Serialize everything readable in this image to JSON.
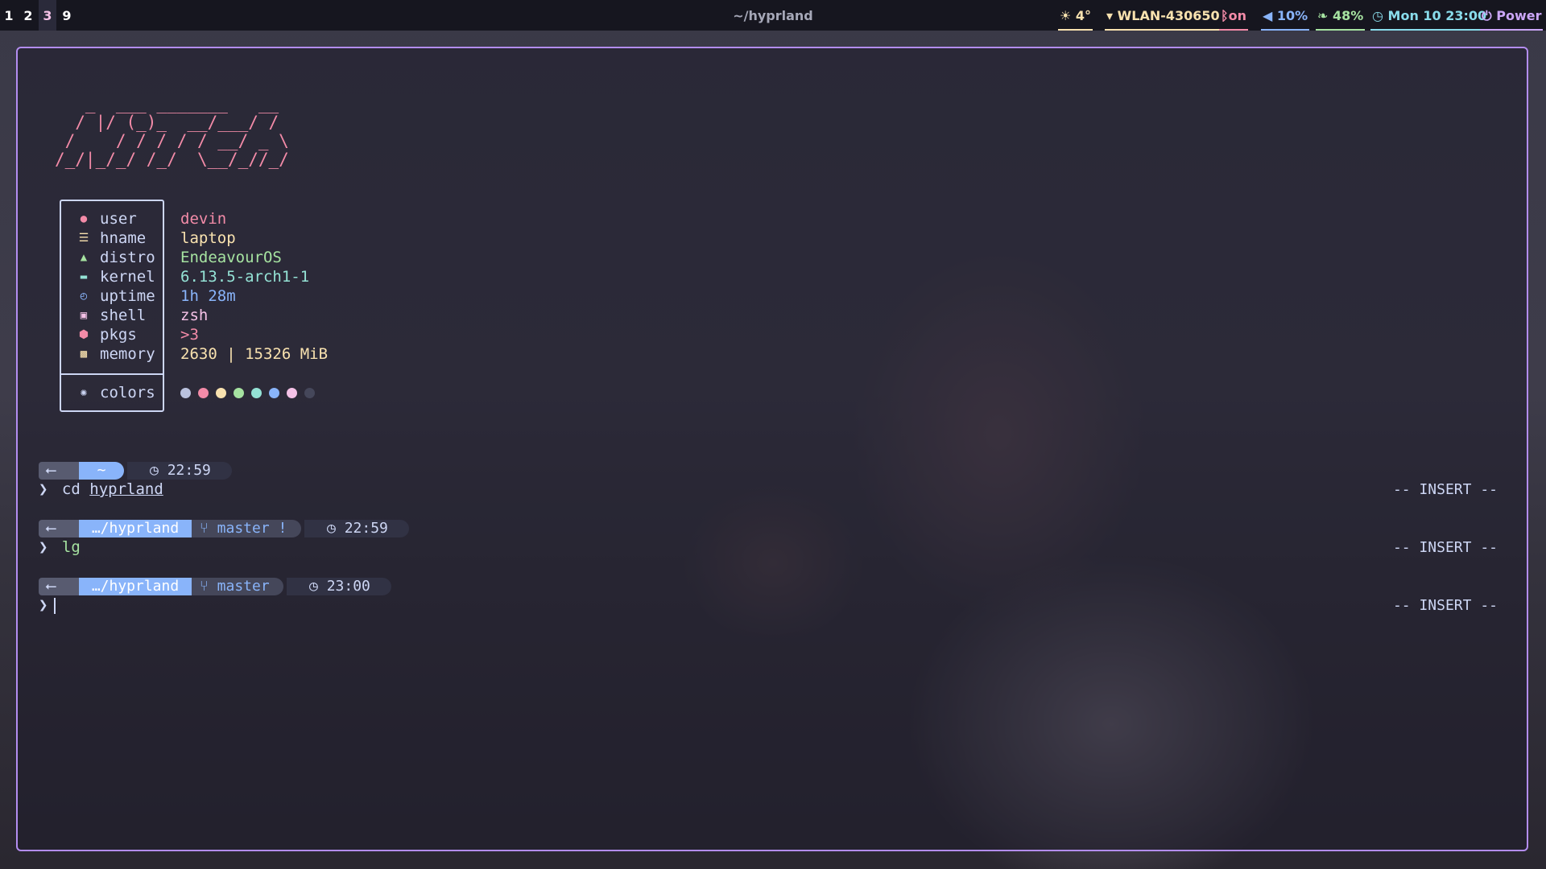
{
  "workspaces": [
    "1",
    "2",
    "3",
    "9"
  ],
  "active_workspace": "3",
  "window_title": "~/hyprland",
  "status": {
    "weather": "4°",
    "wifi": "WLAN-430650",
    "bluetooth": "on",
    "volume": "10%",
    "battery": "48%",
    "clock": "Mon 10 23:00",
    "power": "Power"
  },
  "icons": {
    "weather": "sun-icon",
    "wifi": "wifi-icon",
    "bluetooth": "bluetooth-icon",
    "volume": "speaker-icon",
    "battery": "battery-leaf-icon",
    "clock": "clock-icon",
    "power": "power-icon"
  },
  "ascii_logo": "   _  ___ _______   __\n  / |/ (_)_  __/___/ /\n /    / / / / / __/ _ \\\n/_/|_/_/ /_/  \\__/_//_/",
  "sysinfo": [
    {
      "icon": "user-icon",
      "key": "user",
      "value": "devin",
      "color": "#f38ba8"
    },
    {
      "icon": "hostname-icon",
      "key": "hname",
      "value": "laptop",
      "color": "#f9e2af"
    },
    {
      "icon": "distro-icon",
      "key": "distro",
      "value": "EndeavourOS",
      "color": "#a6e3a1"
    },
    {
      "icon": "kernel-icon",
      "key": "kernel",
      "value": "6.13.5-arch1-1",
      "color": "#94e2d5"
    },
    {
      "icon": "uptime-icon",
      "key": "uptime",
      "value": "1h 28m",
      "color": "#89b4fa"
    },
    {
      "icon": "shell-icon",
      "key": "shell",
      "value": "zsh",
      "color": "#f5c2e7"
    },
    {
      "icon": "package-icon",
      "key": "pkgs",
      "value": ">3",
      "color": "#f38ba8"
    },
    {
      "icon": "memory-icon",
      "key": "memory",
      "value": "2630 | 15326 MiB",
      "color": "#f9e2af"
    }
  ],
  "colors_row": {
    "icon": "palette-icon",
    "key": "colors"
  },
  "color_dots": [
    "#bac2de",
    "#f38ba8",
    "#f9e2af",
    "#a6e3a1",
    "#94e2d5",
    "#89b4fa",
    "#f5c2e7",
    "#45475a"
  ],
  "prompts": [
    {
      "dir": "~",
      "branch": "",
      "time": "22:59",
      "cmd": "cd",
      "arg": "hyprland",
      "mode": "-- INSERT --"
    },
    {
      "dir": "…/hyprland",
      "branch": "master !",
      "time": "22:59",
      "cmd": "lg",
      "arg": "",
      "mode": "-- INSERT --"
    },
    {
      "dir": "…/hyprland",
      "branch": "master",
      "time": "23:00",
      "cmd": "",
      "arg": "",
      "mode": "-- INSERT --"
    }
  ],
  "prompt_symbol": "❯",
  "colors": {
    "accent": "#b38df0",
    "dir_bg": "#89b4fa",
    "branch_bg": "#45475a",
    "time_bg": "#313244",
    "os_bg": "#585b70"
  }
}
